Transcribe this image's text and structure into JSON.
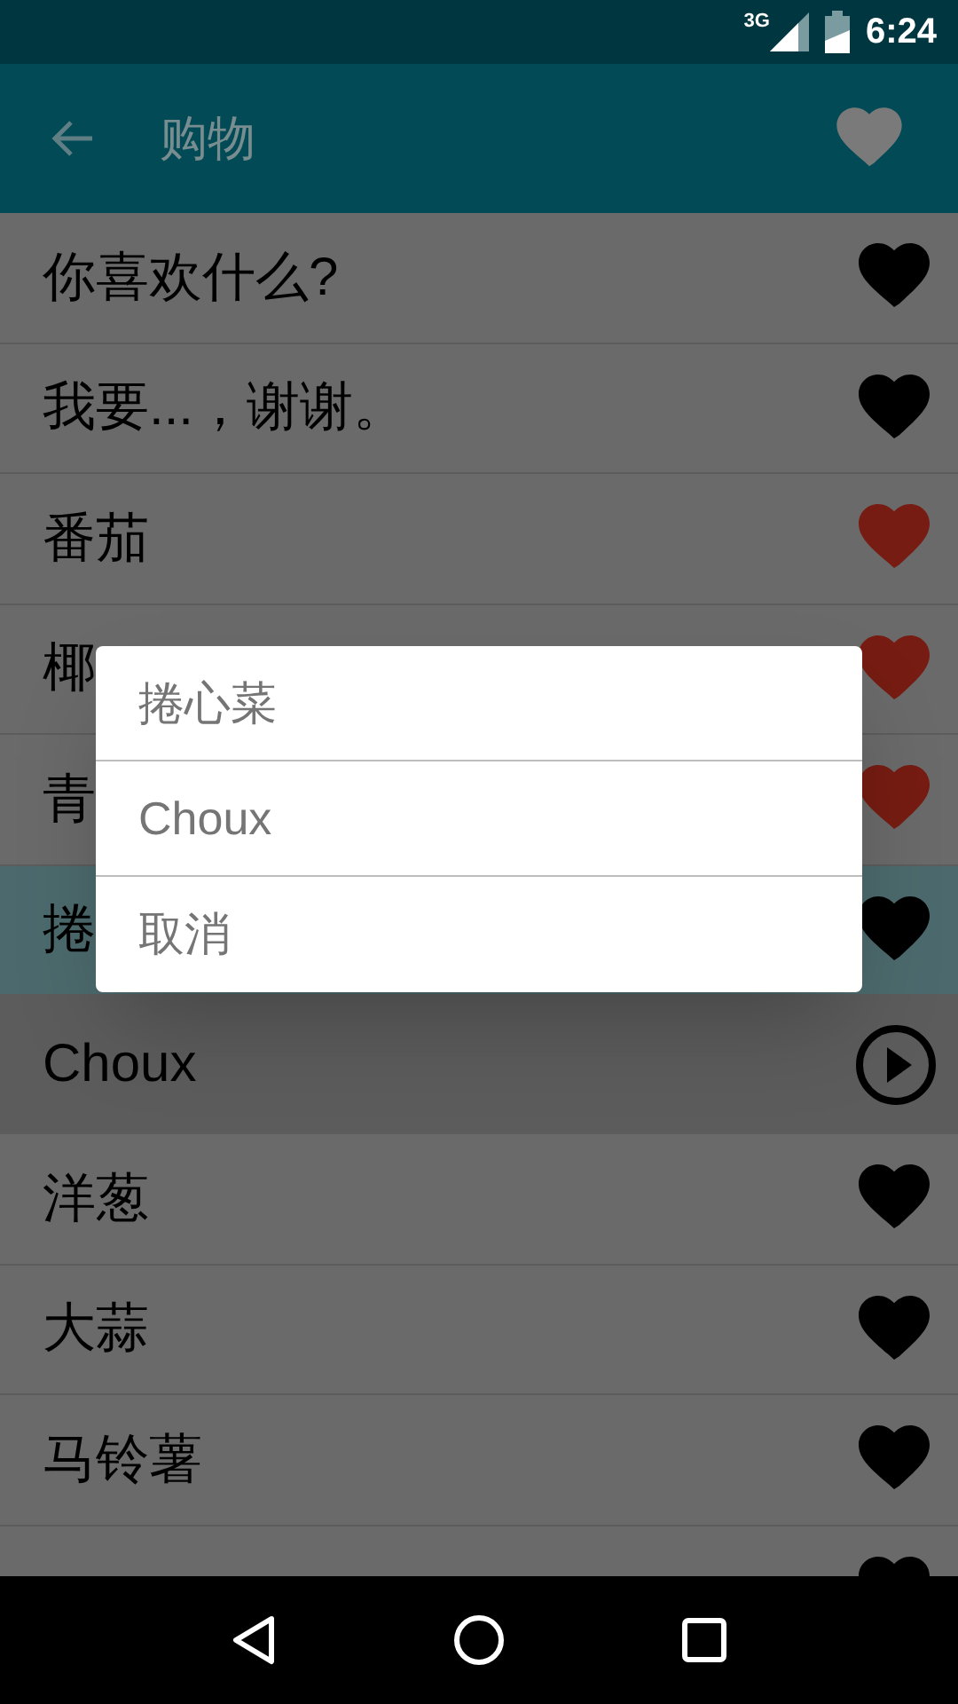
{
  "status_bar": {
    "network": "3G",
    "time": "6:24"
  },
  "app_bar": {
    "title": "购物"
  },
  "rows": [
    {
      "kind": "word",
      "text": "你喜欢什么?",
      "favorite": false,
      "selected": false
    },
    {
      "kind": "word",
      "text": "我要...，谢谢。",
      "favorite": false,
      "selected": false
    },
    {
      "kind": "word",
      "text": "番茄",
      "favorite": true,
      "selected": false
    },
    {
      "kind": "word",
      "text": "椰",
      "favorite": true,
      "selected": false
    },
    {
      "kind": "word",
      "text": "青",
      "favorite": true,
      "selected": false
    },
    {
      "kind": "word",
      "text": "捲",
      "favorite": false,
      "selected": true
    },
    {
      "kind": "translation",
      "text": "Choux",
      "selected": false
    },
    {
      "kind": "word",
      "text": "洋葱",
      "favorite": false,
      "selected": false
    },
    {
      "kind": "word",
      "text": "大蒜",
      "favorite": false,
      "selected": false
    },
    {
      "kind": "word",
      "text": "马铃薯",
      "favorite": false,
      "selected": false
    },
    {
      "kind": "word",
      "favorite": false,
      "selected": false
    }
  ],
  "dialog": {
    "items": [
      "捲心菜",
      "Choux",
      "取消"
    ]
  }
}
